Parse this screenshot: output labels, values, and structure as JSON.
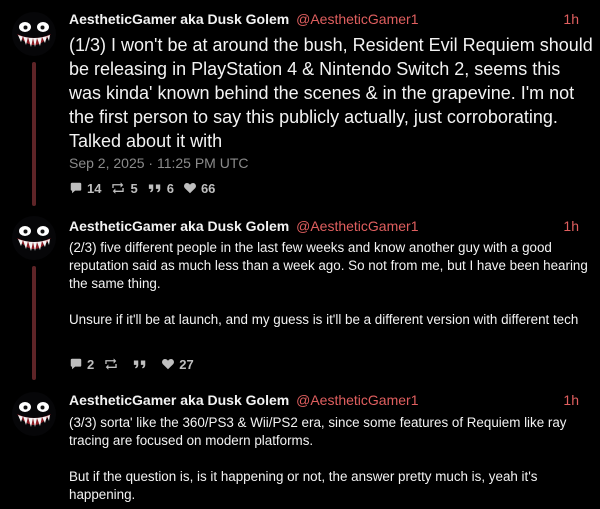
{
  "colors": {
    "background": "#000000",
    "accent": "#e05f5f",
    "thread_line": "#5e2427",
    "muted_text": "#8b8b8b",
    "stat_text": "#bfbfbf"
  },
  "tweets": [
    {
      "author": {
        "display_name": "AestheticGamer aka Dusk Golem",
        "handle": "@AestheticGamer1",
        "avatar_icon": "grinning-monster-avatar-icon"
      },
      "time": "1h",
      "text": "(1/3) I won't be at around the bush, Resident Evil Requiem should be releasing in PlayStation 4 & Nintendo Switch 2, seems this was kinda' known behind the scenes & in the grapevine. I'm not the first person to say this publicly actually, just corroborating. Talked about it with",
      "date": "Sep 2, 2025 · 11:25 PM UTC",
      "stats": {
        "replies": "14",
        "retweets": "5",
        "quotes": "6",
        "likes": "66"
      }
    },
    {
      "author": {
        "display_name": "AestheticGamer aka Dusk Golem",
        "handle": "@AestheticGamer1",
        "avatar_icon": "grinning-monster-avatar-icon"
      },
      "time": "1h",
      "text": "(2/3) five different people in the last few weeks and know another guy with a good reputation said as much less than a week ago. So not from me, but I have been hearing the same thing.\n\nUnsure if it'll be at launch, and my guess is it'll be a different version with different tech",
      "stats": {
        "replies": "2",
        "retweets": "",
        "quotes": "",
        "likes": "27"
      }
    },
    {
      "author": {
        "display_name": "AestheticGamer aka Dusk Golem",
        "handle": "@AestheticGamer1",
        "avatar_icon": "grinning-monster-avatar-icon"
      },
      "time": "1h",
      "text": "(3/3) sorta' like the 360/PS3 & Wii/PS2 era, since some features of Requiem like ray tracing are focused on modern platforms.\n\nBut if the question is, is it happening or not, the answer pretty much is, yeah it's happening."
    }
  ]
}
